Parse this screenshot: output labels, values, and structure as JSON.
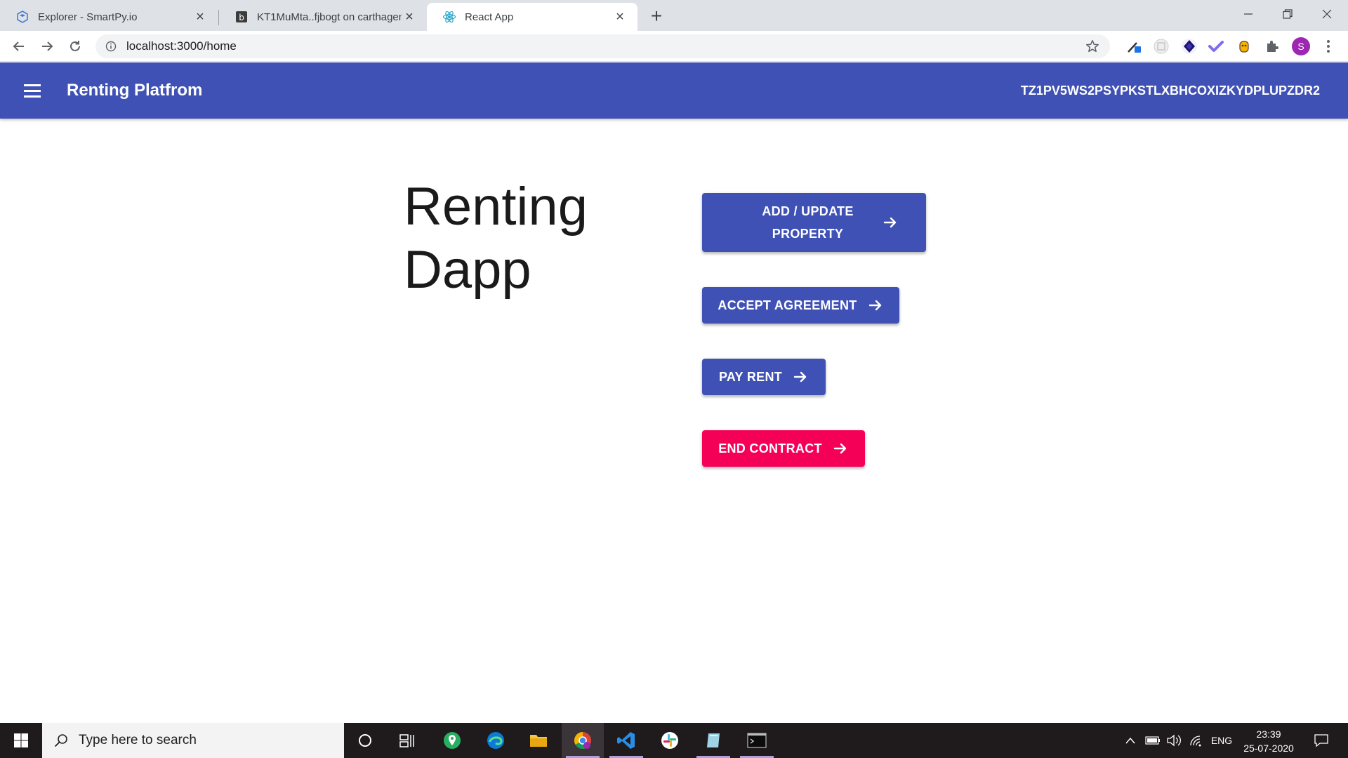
{
  "browser": {
    "tabs": [
      {
        "title": "Explorer - SmartPy.io",
        "icon": "smartpy-icon"
      },
      {
        "title": "KT1MuMta..fjbogt on carthagenet",
        "icon": "better-call-dev-icon"
      },
      {
        "title": "React App",
        "icon": "react-icon",
        "active": true
      }
    ],
    "url": "localhost:3000/home",
    "profile_initial": "S"
  },
  "appbar": {
    "title": "Renting Platfrom",
    "account": "TZ1PV5WS2PSYPKSTLXBHCOXIZKYDPLUPZDR2",
    "color": "#3f51b5"
  },
  "main": {
    "heading_line1": "Renting",
    "heading_line2": "Dapp",
    "buttons": [
      {
        "line1": "ADD / UPDATE",
        "line2": "PROPERTY",
        "color": "#3f51b5"
      },
      {
        "label": "ACCEPT AGREEMENT",
        "color": "#3f51b5"
      },
      {
        "label": "PAY RENT",
        "color": "#3f51b5"
      },
      {
        "label": "END CONTRACT",
        "color": "#f50057"
      }
    ]
  },
  "taskbar": {
    "search_placeholder": "Type here to search",
    "language": "ENG",
    "time": "23:39",
    "date": "25-07-2020"
  }
}
